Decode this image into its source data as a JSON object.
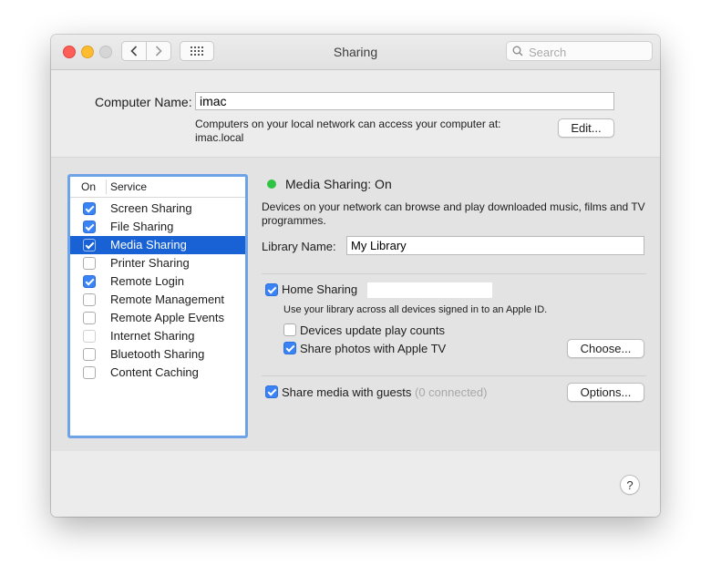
{
  "window": {
    "title": "Sharing"
  },
  "search": {
    "placeholder": "Search"
  },
  "computer": {
    "label": "Computer Name:",
    "value": "imac",
    "help_line1": "Computers on your local network can access your computer at:",
    "help_line2": "imac.local",
    "edit_button": "Edit..."
  },
  "services": {
    "col_on": "On",
    "col_service": "Service",
    "items": [
      {
        "name": "Screen Sharing",
        "enabled": true
      },
      {
        "name": "File Sharing",
        "enabled": true
      },
      {
        "name": "Media Sharing",
        "enabled": true,
        "selected": true
      },
      {
        "name": "Printer Sharing",
        "enabled": false
      },
      {
        "name": "Remote Login",
        "enabled": true
      },
      {
        "name": "Remote Management",
        "enabled": false
      },
      {
        "name": "Remote Apple Events",
        "enabled": false
      },
      {
        "name": "Internet Sharing",
        "enabled": false,
        "dim": true
      },
      {
        "name": "Bluetooth Sharing",
        "enabled": false
      },
      {
        "name": "Content Caching",
        "enabled": false
      }
    ]
  },
  "detail": {
    "status": "Media Sharing: On",
    "status_color": "#2fc344",
    "description": "Devices on your network can browse and play downloaded music, films and TV programmes.",
    "library_label": "Library Name:",
    "library_value": "My Library",
    "home_sharing": {
      "label": "Home Sharing",
      "enabled": true,
      "field_value": "",
      "help": "Use your library across all devices signed in to an Apple ID."
    },
    "update_counts": {
      "label": "Devices update play counts",
      "enabled": false
    },
    "share_photos": {
      "label": "Share photos with Apple TV",
      "enabled": true
    },
    "choose_button": "Choose...",
    "guests": {
      "label": "Share media with guests",
      "count": "(0 connected)",
      "enabled": true
    },
    "options_button": "Options..."
  },
  "help_button": "?",
  "colors": {
    "accent": "#3a83f7",
    "selection": "#1862d6",
    "list_focus": "#6ea3e8"
  }
}
